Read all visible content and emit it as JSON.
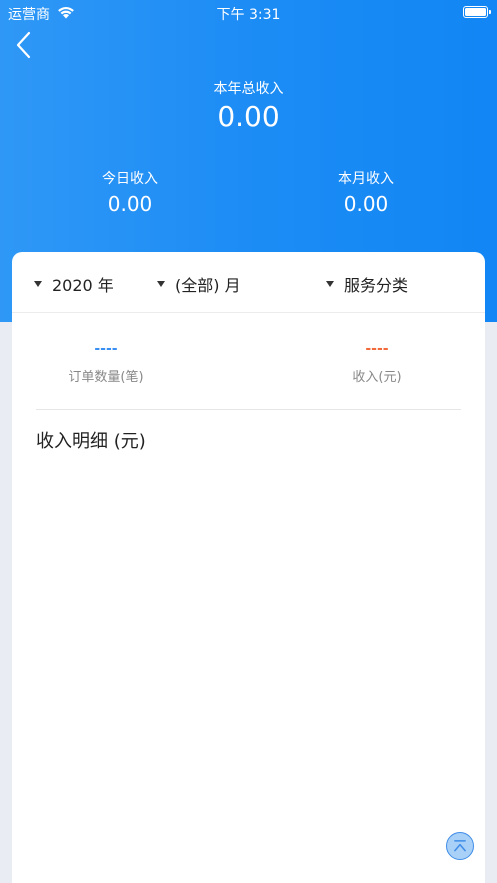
{
  "status_bar": {
    "carrier": "运营商",
    "time": "下午 3:31"
  },
  "summary": {
    "year_label": "本年总收入",
    "year_value": "0.00",
    "today_label": "今日收入",
    "today_value": "0.00",
    "month_label": "本月收入",
    "month_value": "0.00"
  },
  "filters": {
    "year": "2020 年",
    "month": "(全部) 月",
    "category": "服务分类"
  },
  "stats": {
    "orders_value": "----",
    "orders_label": "订单数量(笔)",
    "income_value": "----",
    "income_label": "收入(元)"
  },
  "detail": {
    "title": "收入明细 (元)"
  },
  "colors": {
    "header_blue": "#1e8df5",
    "orders_accent": "#3a8ff2",
    "income_accent": "#f26a3a"
  },
  "icons": [
    "wifi-icon",
    "battery-icon",
    "back-arrow-icon",
    "caret-down-icon",
    "scroll-top-icon"
  ]
}
